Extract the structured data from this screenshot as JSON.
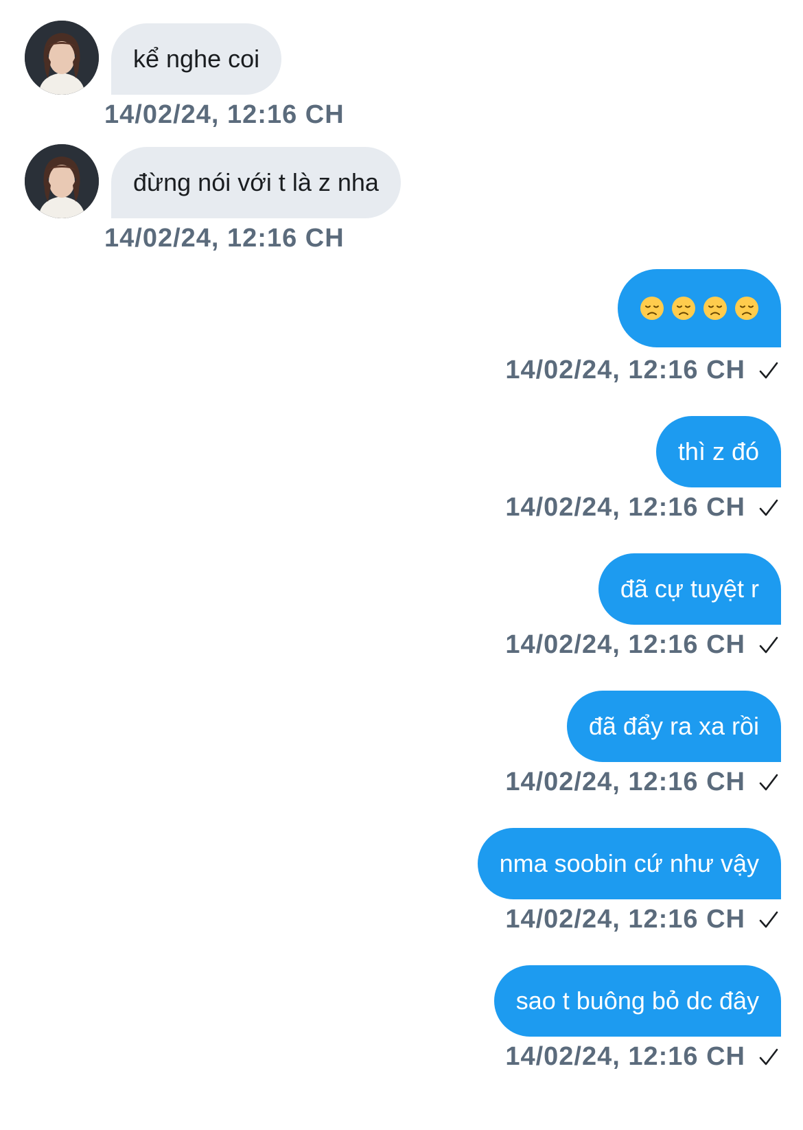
{
  "colors": {
    "incoming_bubble": "#e7ebf0",
    "outgoing_bubble": "#1d9bf0",
    "timestamp": "#5b6b7c"
  },
  "messages": [
    {
      "direction": "incoming",
      "text": "kể nghe coi",
      "timestamp": "14/02/24, 12:16 CH"
    },
    {
      "direction": "incoming",
      "text": "đừng nói với t là z nha",
      "timestamp": "14/02/24, 12:16 CH"
    },
    {
      "direction": "outgoing",
      "text": "😞😞😞😞",
      "icons": [
        "disappointed-face-emoji",
        "disappointed-face-emoji",
        "disappointed-face-emoji",
        "disappointed-face-emoji"
      ],
      "timestamp": "14/02/24, 12:16 CH",
      "status_icon": "checkmark-icon"
    },
    {
      "direction": "outgoing",
      "text": "thì z đó",
      "timestamp": "14/02/24, 12:16 CH",
      "status_icon": "checkmark-icon"
    },
    {
      "direction": "outgoing",
      "text": "đã cự tuyệt r",
      "timestamp": "14/02/24, 12:16 CH",
      "status_icon": "checkmark-icon"
    },
    {
      "direction": "outgoing",
      "text": "đã đẩy ra xa rồi",
      "timestamp": "14/02/24, 12:16 CH",
      "status_icon": "checkmark-icon"
    },
    {
      "direction": "outgoing",
      "text": "nma soobin cứ như vậy",
      "timestamp": "14/02/24, 12:16 CH",
      "status_icon": "checkmark-icon"
    },
    {
      "direction": "outgoing",
      "text": "sao t buông bỏ dc đây",
      "timestamp": "14/02/24, 12:16 CH",
      "status_icon": "checkmark-icon"
    }
  ]
}
